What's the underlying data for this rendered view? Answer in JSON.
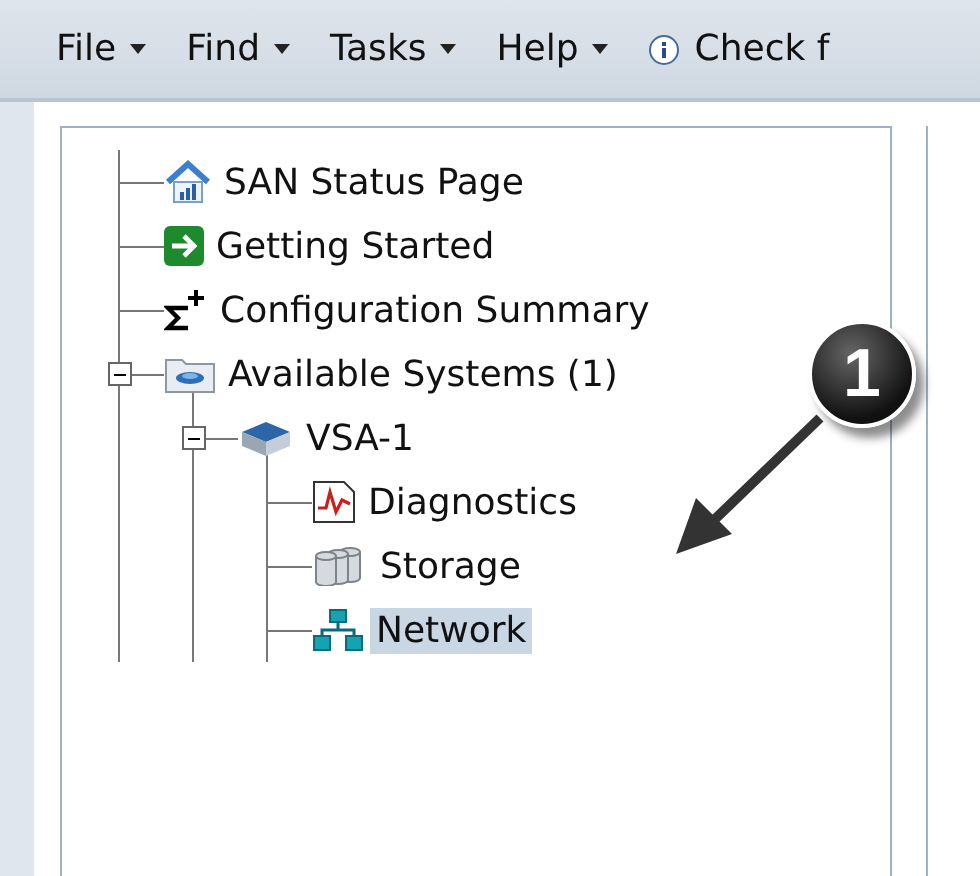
{
  "menu_bar": {
    "items": [
      {
        "label": "File"
      },
      {
        "label": "Find"
      },
      {
        "label": "Tasks"
      },
      {
        "label": "Help"
      }
    ],
    "check_link": "Check f"
  },
  "tree": [
    {
      "label": "SAN Status Page",
      "kind": "home",
      "selected": false
    },
    {
      "label": "Getting Started",
      "kind": "start",
      "selected": false
    },
    {
      "label": "Configuration Summary",
      "kind": "sigma",
      "selected": false
    },
    {
      "label": "Available Systems (1)",
      "kind": "folder",
      "selected": false,
      "expanded": true,
      "children": [
        {
          "label": "VSA-1",
          "kind": "system",
          "selected": false,
          "expanded": true,
          "children": [
            {
              "label": "Diagnostics",
              "kind": "chart",
              "selected": false
            },
            {
              "label": "Storage",
              "kind": "disks",
              "selected": false
            },
            {
              "label": "Network",
              "kind": "network",
              "selected": true
            }
          ]
        }
      ]
    }
  ],
  "callout": {
    "number": "1"
  }
}
